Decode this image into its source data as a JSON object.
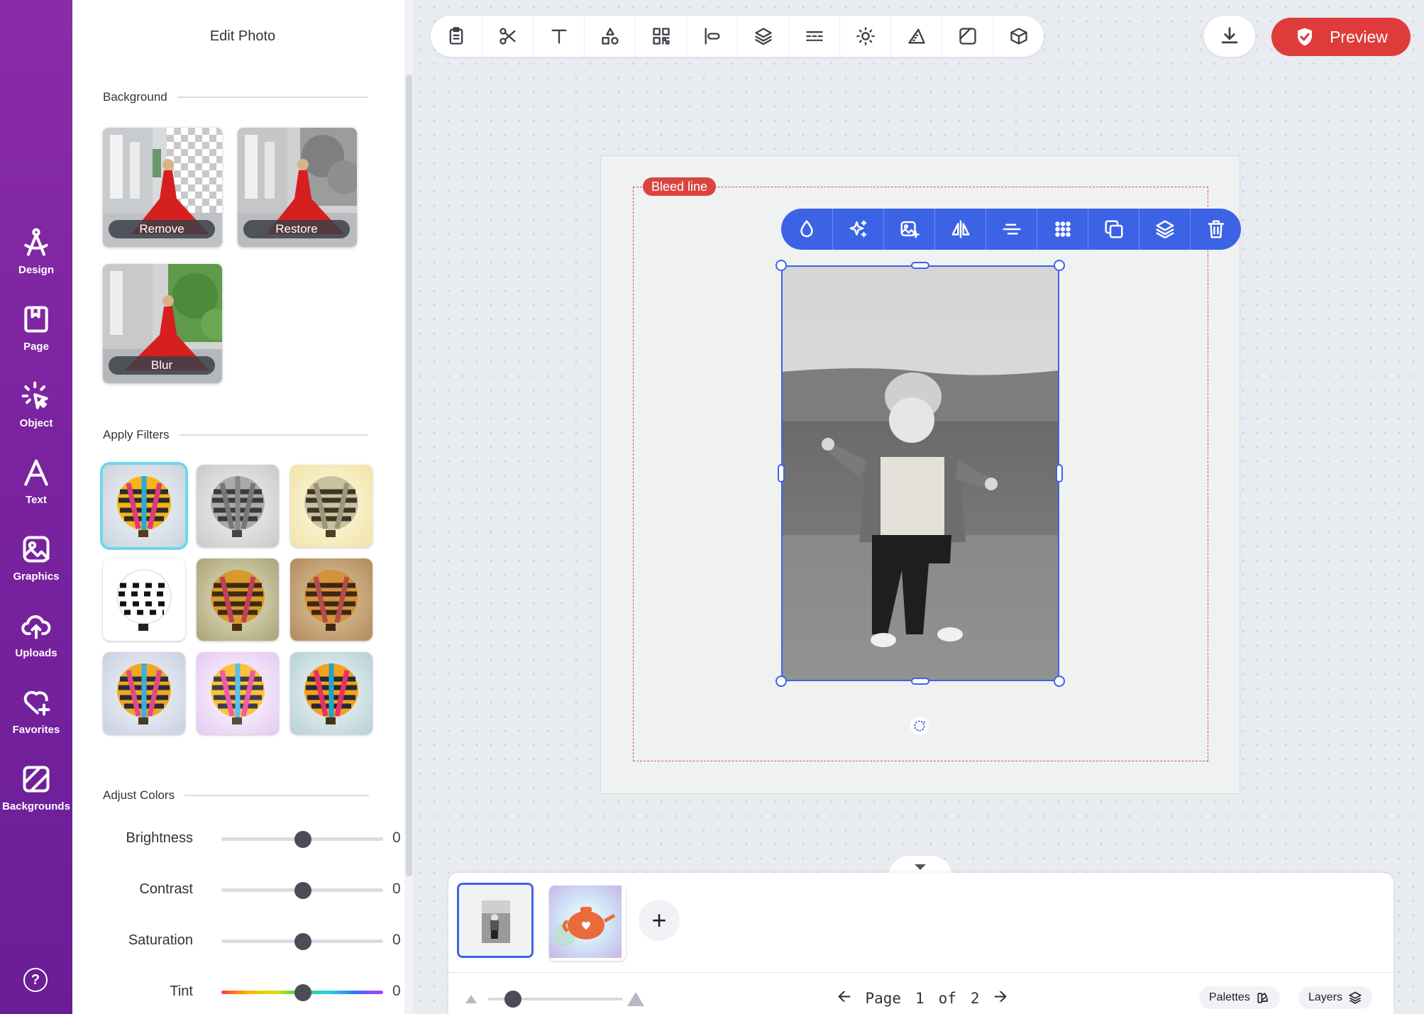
{
  "rail": {
    "items": [
      {
        "label": "Design",
        "icon": "compass-icon"
      },
      {
        "label": "Page",
        "icon": "bookmark-page-icon"
      },
      {
        "label": "Object",
        "icon": "cursor-click-icon"
      },
      {
        "label": "Text",
        "icon": "letter-a-icon"
      },
      {
        "label": "Graphics",
        "icon": "image-icon"
      },
      {
        "label": "Uploads",
        "icon": "cloud-upload-icon"
      },
      {
        "label": "Favorites",
        "icon": "heart-plus-icon"
      },
      {
        "label": "Backgrounds",
        "icon": "background-icon"
      }
    ],
    "help": "?"
  },
  "panel": {
    "title": "Edit Photo",
    "background_section": "Background",
    "bg_options": [
      "Remove",
      "Restore",
      "Blur"
    ],
    "filters_section": "Apply Filters",
    "filters_selected_index": 0,
    "adjust_section": "Adjust Colors",
    "adjustments": [
      {
        "name": "Brightness",
        "value": "0"
      },
      {
        "name": "Contrast",
        "value": "0"
      },
      {
        "name": "Saturation",
        "value": "0"
      },
      {
        "name": "Tint",
        "value": "0"
      }
    ]
  },
  "toolbar": {
    "tools": [
      "clipboard-icon",
      "scissors-icon",
      "text-icon",
      "shapes-icon",
      "qr-code-icon",
      "align-icon",
      "layers-icon",
      "dash-line-icon",
      "brightness-icon",
      "triangle-ruler-icon",
      "background-icon",
      "3d-box-icon"
    ],
    "preview_label": "Preview",
    "accent": "#e03b3b"
  },
  "canvas": {
    "bleed_label": "Bleed line",
    "context_tools": [
      "drop-icon",
      "sparkle-icon",
      "image-add-icon",
      "flip-icon",
      "align-center-icon",
      "grid-dots-icon",
      "duplicate-icon",
      "layers-icon",
      "trash-icon"
    ],
    "selection_color": "#3c63e6"
  },
  "pages": {
    "current": "1",
    "total": "2",
    "pager_prefix": "Page",
    "pager_of": "of",
    "add_label": "+",
    "palettes_label": "Palettes",
    "layers_label": "Layers"
  }
}
